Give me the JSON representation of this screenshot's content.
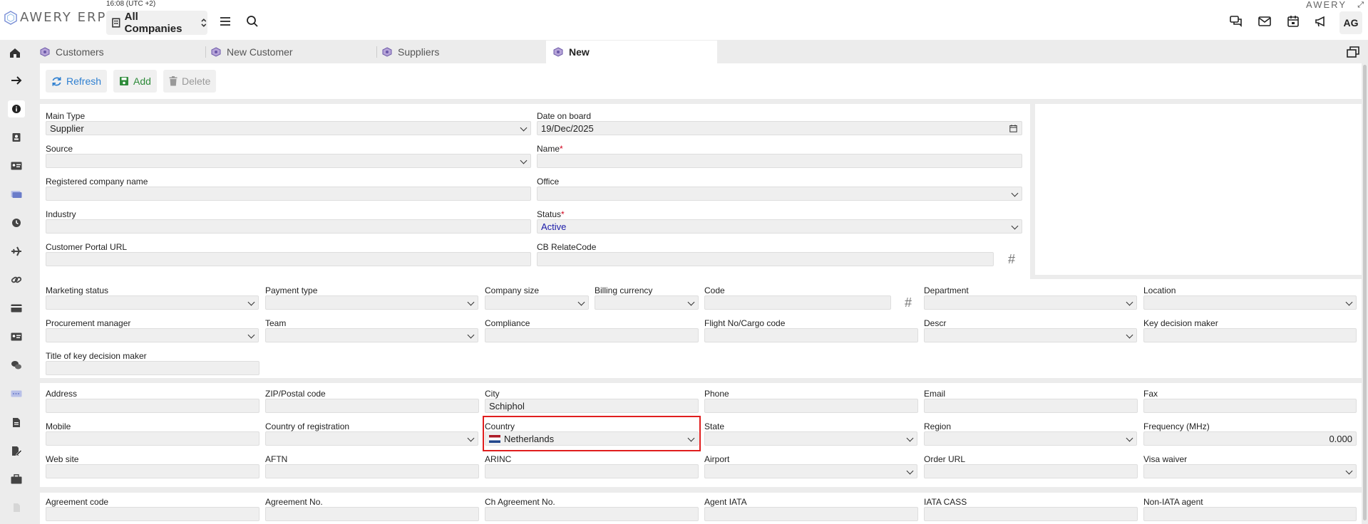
{
  "topbar": {
    "logo_text": "AWERY ERP",
    "clock": "16:08 (UTC +2)",
    "company_select": "All Companies",
    "brand_right": "AWERY",
    "avatar": "AG"
  },
  "tabs": [
    {
      "label": "Customers"
    },
    {
      "label": "New Customer"
    },
    {
      "label": "Suppliers"
    },
    {
      "label": "New"
    }
  ],
  "toolbar": {
    "refresh": "Refresh",
    "add": "Add",
    "delete": "Delete"
  },
  "colors": {
    "accent_blue": "#2f80d1",
    "add_green": "#2e8b3a",
    "highlight": "#e01e1e",
    "status_active": "#1a1aa8"
  },
  "section1": {
    "main_type": {
      "label": "Main Type",
      "value": "Supplier"
    },
    "date_on_board": {
      "label": "Date on board",
      "value": "19/Dec/2025"
    },
    "source": {
      "label": "Source",
      "value": ""
    },
    "name": {
      "label": "Name",
      "value": ""
    },
    "registered_company_name": {
      "label": "Registered company name",
      "value": ""
    },
    "office": {
      "label": "Office",
      "value": ""
    },
    "industry": {
      "label": "Industry",
      "value": ""
    },
    "status": {
      "label": "Status",
      "value": "Active"
    },
    "customer_portal_url": {
      "label": "Customer Portal URL",
      "value": ""
    },
    "cb_relatecode": {
      "label": "CB RelateCode",
      "value": ""
    }
  },
  "section2": {
    "marketing_status": "Marketing status",
    "payment_type": "Payment type",
    "company_size": "Company size",
    "billing_currency": "Billing currency",
    "code": "Code",
    "department": "Department",
    "location": "Location",
    "procurement_manager": "Procurement manager",
    "team": "Team",
    "compliance": "Compliance",
    "flight_no": "Flight No/Cargo code",
    "descr": "Descr",
    "key_decision_maker": "Key decision maker",
    "title_key_decision_maker": "Title of key decision maker"
  },
  "section3": {
    "address": "Address",
    "zip": "ZIP/Postal code",
    "city": {
      "label": "City",
      "value": "Schiphol"
    },
    "phone": "Phone",
    "email": "Email",
    "fax": "Fax",
    "mobile": "Mobile",
    "country_of_registration": "Country of registration",
    "country": {
      "label": "Country",
      "value": "Netherlands"
    },
    "state": "State",
    "region": "Region",
    "frequency": {
      "label": "Frequency (MHz)",
      "value": "0.000"
    },
    "web_site": "Web site",
    "aftn": "AFTN",
    "arinc": "ARINC",
    "airport": "Airport",
    "order_url": "Order URL",
    "visa_waiver": "Visa waiver"
  },
  "section4": {
    "agreement_code": "Agreement code",
    "agreement_no": "Agreement No.",
    "ch_agreement_no": "Ch Agreement No.",
    "agent_iata": "Agent IATA",
    "iata_cass": "IATA CASS",
    "non_iata_agent": "Non-IATA agent"
  }
}
